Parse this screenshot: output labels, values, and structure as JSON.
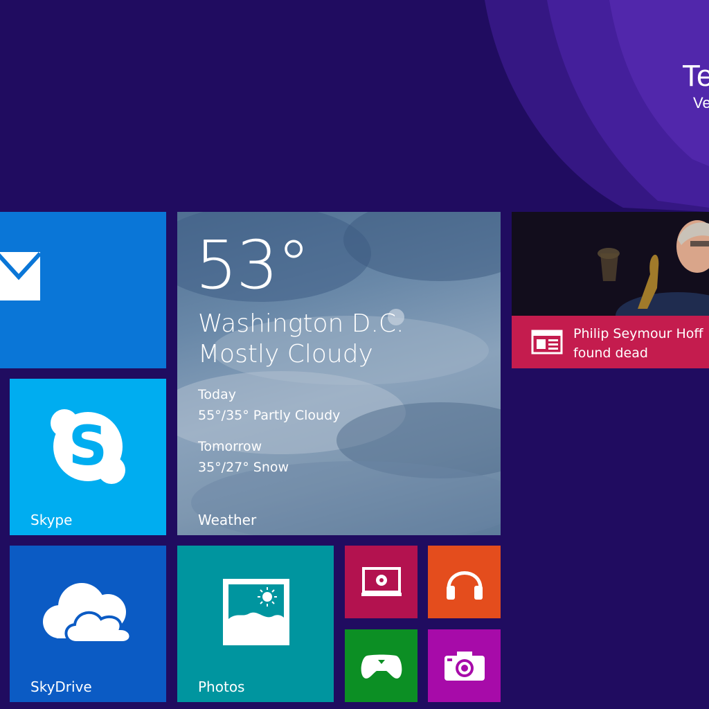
{
  "user": {
    "name": "Te",
    "subtitle": "Ve"
  },
  "tiles": {
    "mail": {
      "icon": "mail-icon"
    },
    "skype": {
      "label": "Skype",
      "icon": "skype-icon"
    },
    "skydrive": {
      "label": "SkyDrive",
      "icon": "cloud-icon"
    },
    "photos": {
      "label": "Photos",
      "icon": "photo-icon"
    },
    "video": {
      "icon": "video-icon"
    },
    "music": {
      "icon": "headphones-icon"
    },
    "games": {
      "icon": "game-controller-icon"
    },
    "camera": {
      "icon": "camera-icon"
    },
    "weather": {
      "label": "Weather",
      "temperature": "53°",
      "city": "Washington D.C.",
      "condition": "Mostly Cloudy",
      "today_label": "Today",
      "today_forecast": "55°/35° Partly Cloudy",
      "tomorrow_label": "Tomorrow",
      "tomorrow_forecast": "35°/27° Snow"
    },
    "news": {
      "headline": "Philip Seymour Hoff\nfound dead",
      "icon": "news-icon"
    }
  },
  "colors": {
    "background": "#200c60",
    "mail": "#0a76d7",
    "skype": "#00adf0",
    "skydrive": "#0b5bc4",
    "photos": "#00959f",
    "video": "#b3124f",
    "music": "#e44d1d",
    "games": "#0c8f24",
    "camera": "#a70ba9",
    "news_band": "#c41c4e"
  }
}
